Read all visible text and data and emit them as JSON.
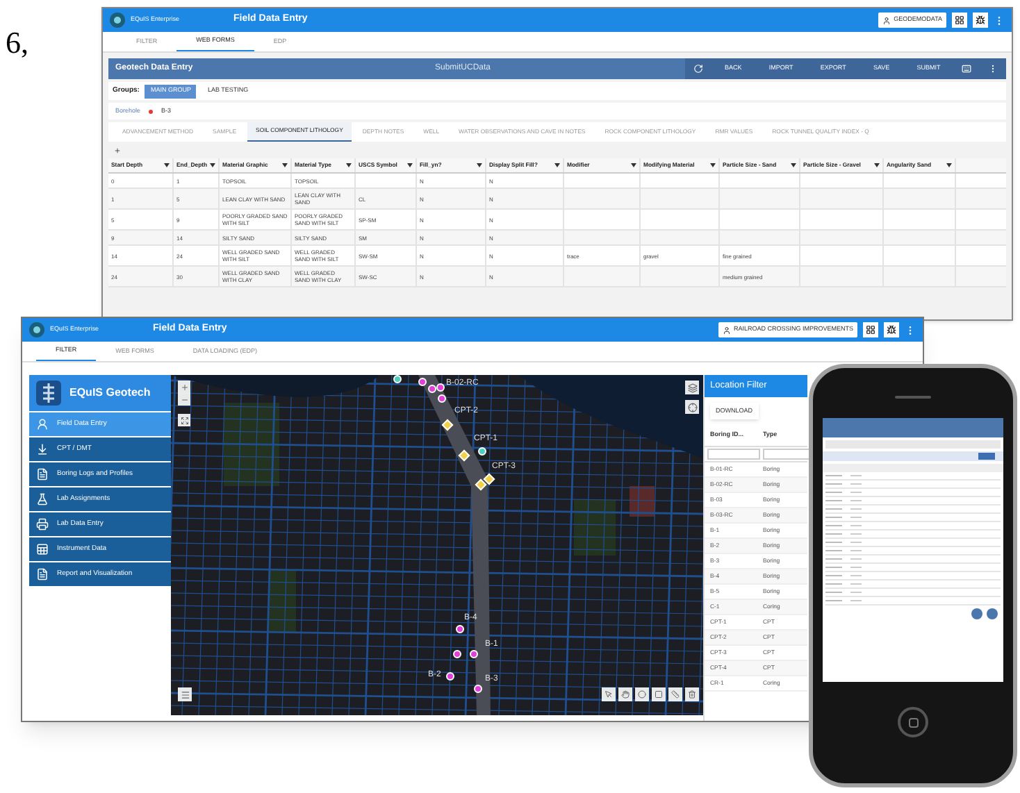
{
  "page_fragment": {
    "text": "6,"
  },
  "back_window": {
    "app_name": "EQuIS Enterprise",
    "title": "Field Data Entry",
    "user_button": "GEODEMODATA",
    "tabs": [
      {
        "label": "FILTER",
        "selected": false
      },
      {
        "label": "WEB FORMS",
        "selected": true
      },
      {
        "label": "EDP",
        "selected": false
      }
    ],
    "form": {
      "title": "Geotech Data Entry",
      "subtitle": "SubmitUCData",
      "actions": [
        "BACK",
        "IMPORT",
        "EXPORT",
        "SAVE",
        "SUBMIT"
      ],
      "groups_label": "Groups:",
      "groups": [
        {
          "label": "MAIN GROUP",
          "selected": true
        },
        {
          "label": "LAB TESTING",
          "selected": false
        }
      ],
      "borehole_label": "Borehole",
      "borehole_value": "B-3",
      "sections": [
        {
          "label": "ADVANCEMENT METHOD",
          "selected": false
        },
        {
          "label": "SAMPLE",
          "selected": false
        },
        {
          "label": "SOIL COMPONENT LITHOLOGY",
          "selected": true
        },
        {
          "label": "DEPTH NOTES",
          "selected": false
        },
        {
          "label": "WELL",
          "selected": false
        },
        {
          "label": "WATER OBSERVATIONS AND CAVE IN NOTES",
          "selected": false
        },
        {
          "label": "ROCK COMPONENT LITHOLOGY",
          "selected": false
        },
        {
          "label": "RMR VALUES",
          "selected": false
        },
        {
          "label": "ROCK TUNNEL QUALITY INDEX - Q",
          "selected": false
        }
      ],
      "table": {
        "columns": [
          "Start Depth",
          "End_Depth",
          "Material Graphic",
          "Material Type",
          "USCS Symbol",
          "Fill_yn?",
          "Display Split Fill?",
          "Modifier",
          "Modifying Material",
          "Particle Size - Sand",
          "Particle Size - Gravel",
          "Angularity Sand"
        ],
        "rows": [
          [
            "0",
            "1",
            "TOPSOIL",
            "TOPSOIL",
            null,
            "N",
            "N",
            null,
            null,
            null,
            null,
            null
          ],
          [
            "1",
            "5",
            "LEAN CLAY WITH SAND",
            "LEAN CLAY WITH SAND",
            "CL",
            "N",
            "N",
            null,
            null,
            null,
            null,
            null
          ],
          [
            "5",
            "9",
            "POORLY GRADED SAND WITH SILT",
            "POORLY GRADED SAND WITH SILT",
            "SP-SM",
            "N",
            "N",
            null,
            null,
            null,
            null,
            null
          ],
          [
            "9",
            "14",
            "SILTY SAND",
            "SILTY SAND",
            "SM",
            "N",
            "N",
            null,
            null,
            null,
            null,
            null
          ],
          [
            "14",
            "24",
            "WELL GRADED SAND WITH SILT",
            "WELL GRADED SAND WITH SILT",
            "SW-SM",
            "N",
            "N",
            "trace",
            "gravel",
            "fine grained",
            null,
            null
          ],
          [
            "24",
            "30",
            "WELL GRADED SAND WITH CLAY",
            "WELL GRADED SAND WITH CLAY",
            "SW-SC",
            "N",
            "N",
            null,
            null,
            "medium grained",
            null,
            null
          ]
        ]
      }
    }
  },
  "front_window": {
    "app_name": "EQuIS Enterprise",
    "title": "Field Data Entry",
    "project_button": "RAILROAD CROSSING IMPROVEMENTS",
    "tabs": [
      {
        "label": "FILTER",
        "selected": true
      },
      {
        "label": "WEB FORMS",
        "selected": false
      },
      {
        "label": "DATA LOADING (EDP)",
        "selected": false
      }
    ],
    "sidebar": {
      "title": "EQuIS Geotech",
      "items": [
        {
          "label": "Field Data Entry",
          "selected": true
        },
        {
          "label": "CPT / DMT",
          "selected": false
        },
        {
          "label": "Boring Logs and Profiles",
          "selected": false
        },
        {
          "label": "Lab Assignments",
          "selected": false
        },
        {
          "label": "Lab Data Entry",
          "selected": false
        },
        {
          "label": "Instrument Data",
          "selected": false
        },
        {
          "label": "Report and Visualization",
          "selected": false
        }
      ]
    },
    "map": {
      "markers": [
        {
          "color": "#4dd0c0"
        },
        {
          "color": "#e040d8"
        },
        {
          "color": "#e040d8"
        },
        {
          "color": "#e040d8",
          "label": "B-02-RC"
        },
        {
          "color": "#e040d8"
        },
        {
          "color": "#f2d04a",
          "label": "CPT-2"
        },
        {
          "color": "#4dd0c0",
          "label": "CPT-1"
        },
        {
          "color": "#f2d04a"
        },
        {
          "color": "#f2d04a",
          "label": "CPT-3"
        },
        {
          "color": "#f2d04a"
        },
        {
          "color": "#e040d8",
          "label": "B-4"
        },
        {
          "color": "#e040d8"
        },
        {
          "color": "#e040d8",
          "label": "B-1"
        },
        {
          "color": "#e040d8",
          "label": "B-2"
        },
        {
          "color": "#e040d8",
          "label": "B-3"
        }
      ]
    },
    "location_filter": {
      "title": "Location Filter",
      "download_button": "DOWNLOAD",
      "columns": [
        "Boring ID...",
        "Type"
      ],
      "rows": [
        [
          "B-01-RC",
          "Boring"
        ],
        [
          "B-02-RC",
          "Boring"
        ],
        [
          "B-03",
          "Boring"
        ],
        [
          "B-03-RC",
          "Boring"
        ],
        [
          "B-1",
          "Boring"
        ],
        [
          "B-2",
          "Boring"
        ],
        [
          "B-3",
          "Boring"
        ],
        [
          "B-4",
          "Boring"
        ],
        [
          "B-5",
          "Boring"
        ],
        [
          "C-1",
          "Coring"
        ],
        [
          "CPT-1",
          "CPT"
        ],
        [
          "CPT-2",
          "CPT"
        ],
        [
          "CPT-3",
          "CPT"
        ],
        [
          "CPT-4",
          "CPT"
        ],
        [
          "CR-1",
          "Coring"
        ]
      ]
    }
  }
}
